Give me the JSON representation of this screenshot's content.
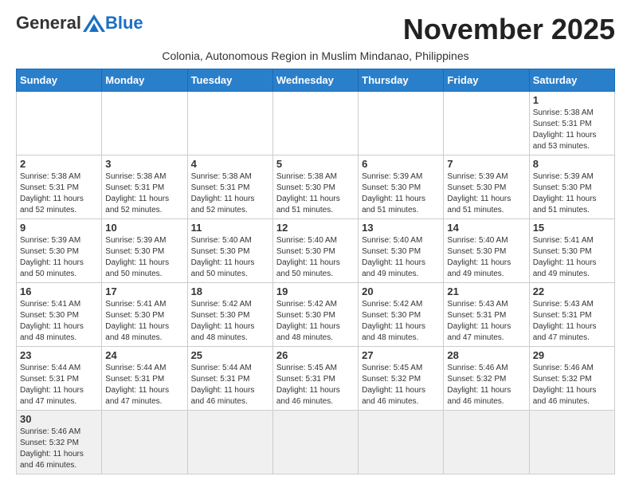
{
  "header": {
    "logo_general": "General",
    "logo_blue": "Blue",
    "month_title": "November 2025",
    "subtitle": "Colonia, Autonomous Region in Muslim Mindanao, Philippines"
  },
  "days_of_week": [
    "Sunday",
    "Monday",
    "Tuesday",
    "Wednesday",
    "Thursday",
    "Friday",
    "Saturday"
  ],
  "weeks": [
    [
      {
        "day": "",
        "info": ""
      },
      {
        "day": "",
        "info": ""
      },
      {
        "day": "",
        "info": ""
      },
      {
        "day": "",
        "info": ""
      },
      {
        "day": "",
        "info": ""
      },
      {
        "day": "",
        "info": ""
      },
      {
        "day": "1",
        "info": "Sunrise: 5:38 AM\nSunset: 5:31 PM\nDaylight: 11 hours\nand 53 minutes."
      }
    ],
    [
      {
        "day": "2",
        "info": "Sunrise: 5:38 AM\nSunset: 5:31 PM\nDaylight: 11 hours\nand 52 minutes."
      },
      {
        "day": "3",
        "info": "Sunrise: 5:38 AM\nSunset: 5:31 PM\nDaylight: 11 hours\nand 52 minutes."
      },
      {
        "day": "4",
        "info": "Sunrise: 5:38 AM\nSunset: 5:31 PM\nDaylight: 11 hours\nand 52 minutes."
      },
      {
        "day": "5",
        "info": "Sunrise: 5:38 AM\nSunset: 5:30 PM\nDaylight: 11 hours\nand 51 minutes."
      },
      {
        "day": "6",
        "info": "Sunrise: 5:39 AM\nSunset: 5:30 PM\nDaylight: 11 hours\nand 51 minutes."
      },
      {
        "day": "7",
        "info": "Sunrise: 5:39 AM\nSunset: 5:30 PM\nDaylight: 11 hours\nand 51 minutes."
      },
      {
        "day": "8",
        "info": "Sunrise: 5:39 AM\nSunset: 5:30 PM\nDaylight: 11 hours\nand 51 minutes."
      }
    ],
    [
      {
        "day": "9",
        "info": "Sunrise: 5:39 AM\nSunset: 5:30 PM\nDaylight: 11 hours\nand 50 minutes."
      },
      {
        "day": "10",
        "info": "Sunrise: 5:39 AM\nSunset: 5:30 PM\nDaylight: 11 hours\nand 50 minutes."
      },
      {
        "day": "11",
        "info": "Sunrise: 5:40 AM\nSunset: 5:30 PM\nDaylight: 11 hours\nand 50 minutes."
      },
      {
        "day": "12",
        "info": "Sunrise: 5:40 AM\nSunset: 5:30 PM\nDaylight: 11 hours\nand 50 minutes."
      },
      {
        "day": "13",
        "info": "Sunrise: 5:40 AM\nSunset: 5:30 PM\nDaylight: 11 hours\nand 49 minutes."
      },
      {
        "day": "14",
        "info": "Sunrise: 5:40 AM\nSunset: 5:30 PM\nDaylight: 11 hours\nand 49 minutes."
      },
      {
        "day": "15",
        "info": "Sunrise: 5:41 AM\nSunset: 5:30 PM\nDaylight: 11 hours\nand 49 minutes."
      }
    ],
    [
      {
        "day": "16",
        "info": "Sunrise: 5:41 AM\nSunset: 5:30 PM\nDaylight: 11 hours\nand 48 minutes."
      },
      {
        "day": "17",
        "info": "Sunrise: 5:41 AM\nSunset: 5:30 PM\nDaylight: 11 hours\nand 48 minutes."
      },
      {
        "day": "18",
        "info": "Sunrise: 5:42 AM\nSunset: 5:30 PM\nDaylight: 11 hours\nand 48 minutes."
      },
      {
        "day": "19",
        "info": "Sunrise: 5:42 AM\nSunset: 5:30 PM\nDaylight: 11 hours\nand 48 minutes."
      },
      {
        "day": "20",
        "info": "Sunrise: 5:42 AM\nSunset: 5:30 PM\nDaylight: 11 hours\nand 48 minutes."
      },
      {
        "day": "21",
        "info": "Sunrise: 5:43 AM\nSunset: 5:31 PM\nDaylight: 11 hours\nand 47 minutes."
      },
      {
        "day": "22",
        "info": "Sunrise: 5:43 AM\nSunset: 5:31 PM\nDaylight: 11 hours\nand 47 minutes."
      }
    ],
    [
      {
        "day": "23",
        "info": "Sunrise: 5:44 AM\nSunset: 5:31 PM\nDaylight: 11 hours\nand 47 minutes."
      },
      {
        "day": "24",
        "info": "Sunrise: 5:44 AM\nSunset: 5:31 PM\nDaylight: 11 hours\nand 47 minutes."
      },
      {
        "day": "25",
        "info": "Sunrise: 5:44 AM\nSunset: 5:31 PM\nDaylight: 11 hours\nand 46 minutes."
      },
      {
        "day": "26",
        "info": "Sunrise: 5:45 AM\nSunset: 5:31 PM\nDaylight: 11 hours\nand 46 minutes."
      },
      {
        "day": "27",
        "info": "Sunrise: 5:45 AM\nSunset: 5:32 PM\nDaylight: 11 hours\nand 46 minutes."
      },
      {
        "day": "28",
        "info": "Sunrise: 5:46 AM\nSunset: 5:32 PM\nDaylight: 11 hours\nand 46 minutes."
      },
      {
        "day": "29",
        "info": "Sunrise: 5:46 AM\nSunset: 5:32 PM\nDaylight: 11 hours\nand 46 minutes."
      }
    ],
    [
      {
        "day": "30",
        "info": "Sunrise: 5:46 AM\nSunset: 5:32 PM\nDaylight: 11 hours\nand 46 minutes."
      },
      {
        "day": "",
        "info": ""
      },
      {
        "day": "",
        "info": ""
      },
      {
        "day": "",
        "info": ""
      },
      {
        "day": "",
        "info": ""
      },
      {
        "day": "",
        "info": ""
      },
      {
        "day": "",
        "info": ""
      }
    ]
  ]
}
